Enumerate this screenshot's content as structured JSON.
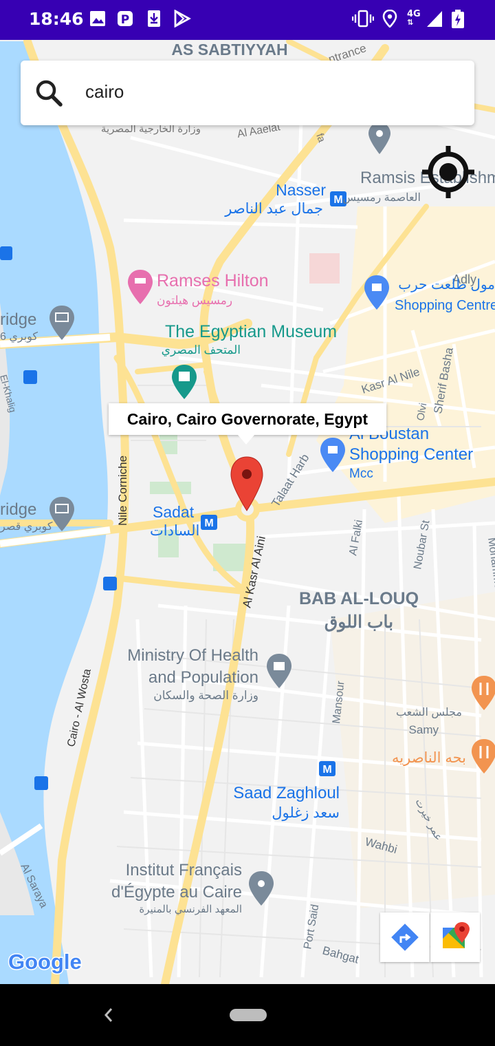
{
  "status_bar": {
    "time": "18:46",
    "network": "4G",
    "notification_icons": [
      "image-icon",
      "p-icon",
      "download-icon",
      "play-store-icon"
    ],
    "system_icons": [
      "vibrate-icon",
      "location-icon",
      "signal-icon",
      "battery-icon"
    ]
  },
  "search": {
    "query": "cairo"
  },
  "info_window": {
    "title": "Cairo, Cairo Governorate, Egypt"
  },
  "map": {
    "districts": [
      "AS SABTIYYAH",
      "BAB AL-LOUQ",
      "باب اللوق"
    ],
    "places": {
      "nasser": "Nasser",
      "nasser_ar": "جمال عبد الناصر",
      "ramsis": "Ramsis Establishm",
      "ramsis_ar": "العاصمة رمسيس",
      "ramses_hilton": "Ramses Hilton",
      "ramses_hilton_ar": "رمسيس هيلتون",
      "museum": "The Egyptian Museum",
      "museum_ar": "المتحف المصري",
      "adly": "Adly",
      "mall_ar": "مول طلعت حرب",
      "shopping_centre": "Shopping Centre",
      "kasr_al_nile": "Kasr Al Nile",
      "sherif_basha": "Sherif Basha",
      "olvi": "Olvi",
      "al_boustan": "Al Boustan",
      "al_boustan_2": "Shopping Center",
      "mcc": "Mcc",
      "talaat_harb": "Talaat Harb",
      "sadat": "Sadat",
      "sadat_ar": "السادات",
      "nile_corniche": "Nile Corniche",
      "al_kasr_al_aini": "Al Kasr Al Aini",
      "al_falki": "Al Falki",
      "noubar_st": "Noubar St",
      "mohammed_farid": "Mohammed Farid",
      "ministry_1": "Ministry Of Health",
      "ministry_2": "and Population",
      "ministry_ar": "وزارة الصحة والسكان",
      "cairo_al_wosta": "Cairo - Al Wosta",
      "mansour": "Mansour",
      "samy": "Samy",
      "majlis_ar": "مجلس الشعب",
      "bahha_ar": "بحه الناصريه",
      "saad_zaghloul": "Saad Zaghloul",
      "saad_zaghloul_ar": "سعد زغلول",
      "wahbi": "Wahbi",
      "omar_ar": "عمر خيرت",
      "institut_1": "Institut Français",
      "institut_2": "d'Égypte au Caire",
      "institut_ar": "المعهد الفرنسي بالمنيرة",
      "al_saraya": "Al Saraya",
      "port_said": "Port Said",
      "bahgat": "Bahgat",
      "bridge": "ridge",
      "bridge_ar": "كوبري 6",
      "bridge_2": "ridge",
      "bridge_2_ar": "كوبري قصر",
      "el_khalig": "El-Khalig",
      "al_aaelat": "Al Aaelat",
      "ministry_foreign_ar": "وزارة الخارجية المصرية",
      "entrance": "ntrance",
      "fa": "fa"
    }
  },
  "attribution": "Google",
  "colors": {
    "status_bar": "#3700b3",
    "water": "#aadaff",
    "land": "#f2f2f2",
    "arterial": "#fde293",
    "marker": "#ea4335",
    "transit_label": "#1a73e8",
    "poi_pink": "#e76fae",
    "poi_teal": "#16998b"
  }
}
